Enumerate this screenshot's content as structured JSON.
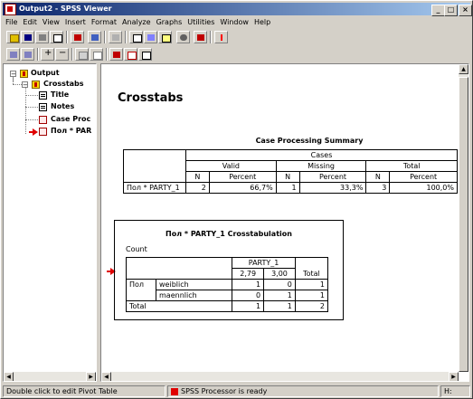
{
  "window": {
    "title": "Output2 - SPSS Viewer"
  },
  "menu": [
    "File",
    "Edit",
    "View",
    "Insert",
    "Format",
    "Analyze",
    "Graphs",
    "Utilities",
    "Window",
    "Help"
  ],
  "outline": {
    "root": "Output",
    "group": "Crosstabs",
    "items": [
      "Title",
      "Notes",
      "Case Proc",
      "Пол * PAR"
    ]
  },
  "content": {
    "heading": "Crosstabs",
    "case_summary": {
      "title": "Case Processing Summary",
      "cases_label": "Cases",
      "groups": [
        "Valid",
        "Missing",
        "Total"
      ],
      "subheaders": [
        "N",
        "Percent",
        "N",
        "Percent",
        "N",
        "Percent"
      ],
      "row_label": "Пол * PARTY_1",
      "values": [
        "2",
        "66,7%",
        "1",
        "33,3%",
        "3",
        "100,0%"
      ]
    },
    "crosstab": {
      "title": "Пол * PARTY_1 Crosstabulation",
      "count_label": "Count",
      "col_var": "PARTY_1",
      "col_values": [
        "2,79",
        "3,00"
      ],
      "total_label": "Total",
      "row_var": "Пол",
      "rows": [
        {
          "label": "weiblich",
          "values": [
            "1",
            "0",
            "1"
          ]
        },
        {
          "label": "maennlich",
          "values": [
            "0",
            "1",
            "1"
          ]
        }
      ],
      "total_row": {
        "label": "Total",
        "values": [
          "1",
          "1",
          "2"
        ]
      }
    }
  },
  "status": {
    "hint": "Double click to edit Pivot Table",
    "processor": "SPSS Processor  is ready",
    "indicator": "H:"
  }
}
